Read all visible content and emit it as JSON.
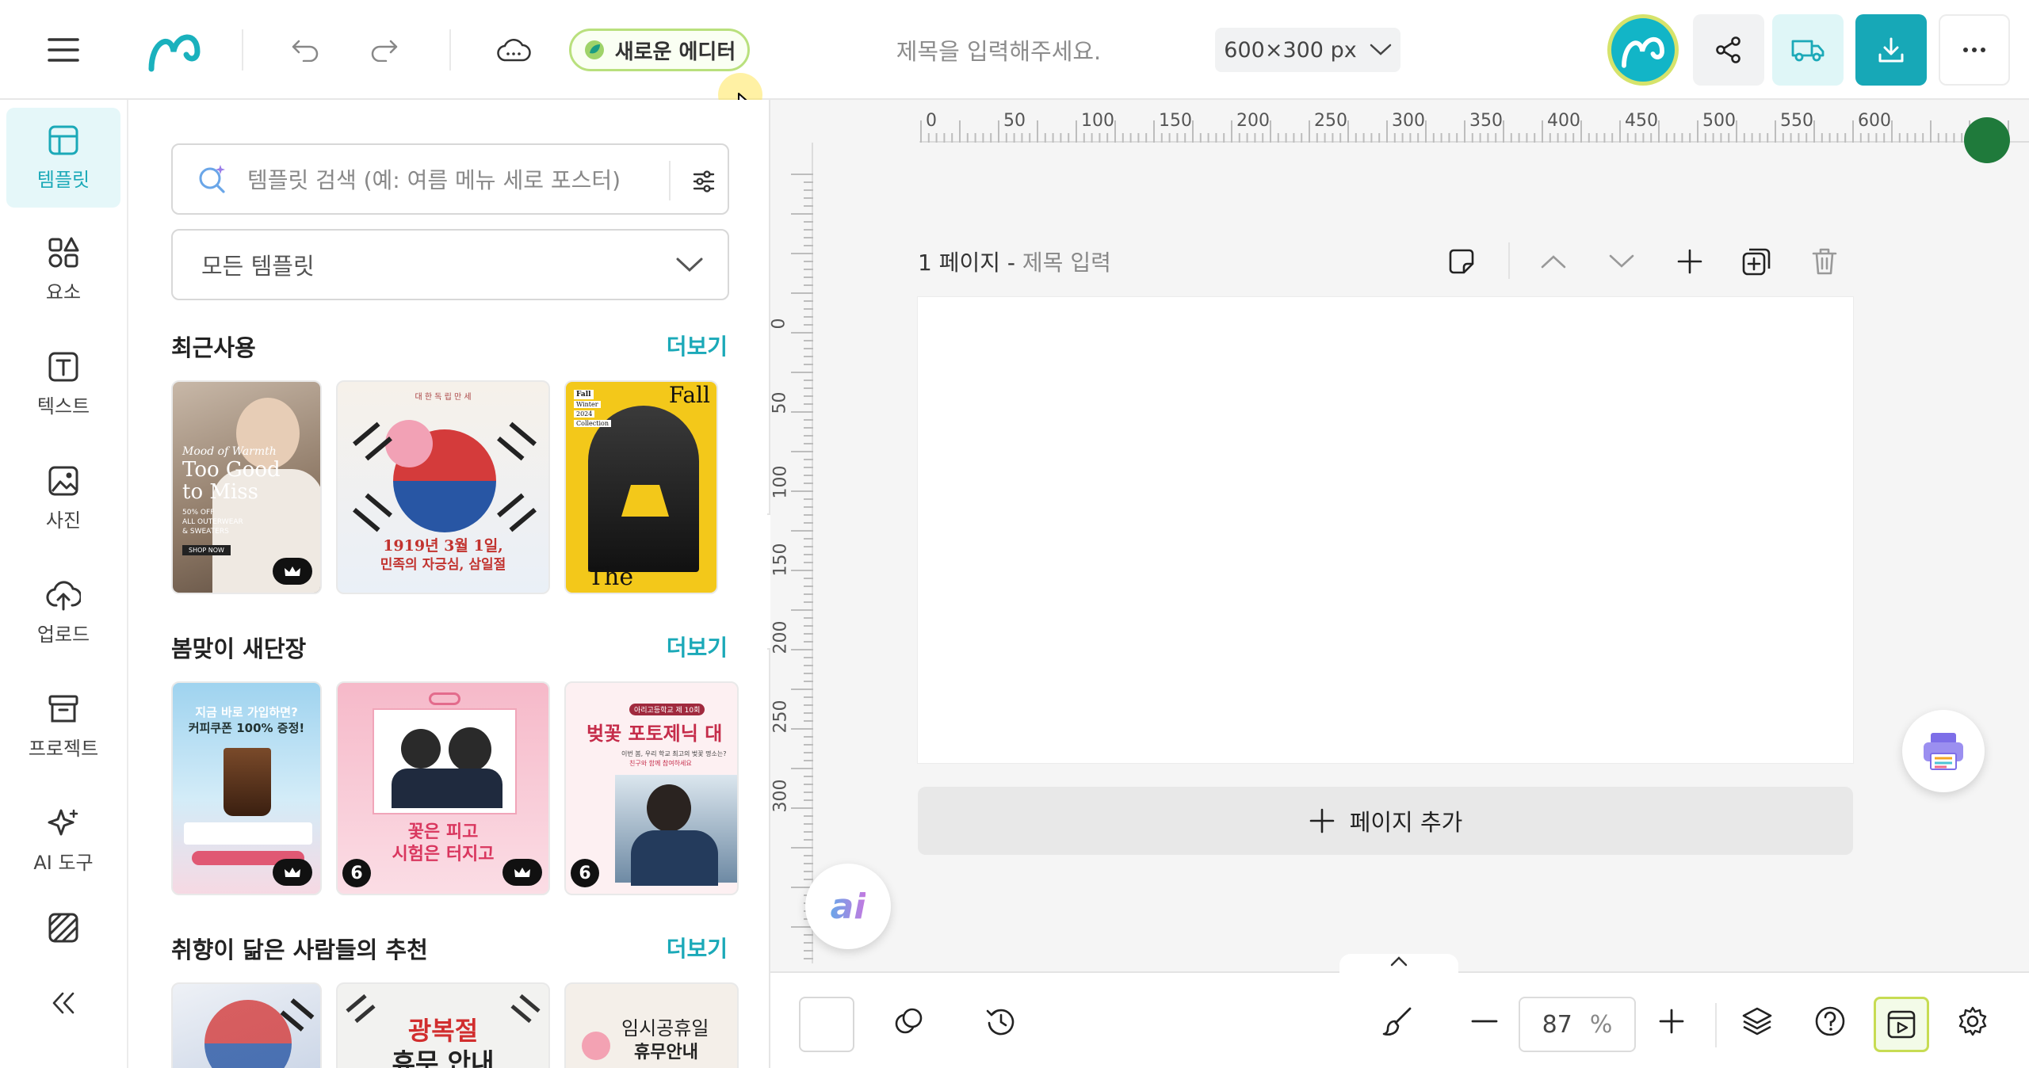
{
  "topbar": {
    "new_editor_label": "새로운 에디터",
    "title_placeholder": "제목을 입력해주세요.",
    "canvas_size": "600×300 px"
  },
  "rail": {
    "items": [
      {
        "label": "템플릿",
        "icon": "template-icon",
        "active": true
      },
      {
        "label": "요소",
        "icon": "elements-icon"
      },
      {
        "label": "텍스트",
        "icon": "text-icon"
      },
      {
        "label": "사진",
        "icon": "photo-icon"
      },
      {
        "label": "업로드",
        "icon": "upload-cloud-icon"
      },
      {
        "label": "프로젝트",
        "icon": "project-box-icon"
      },
      {
        "label": "AI 도구",
        "icon": "ai-sparkle-icon"
      },
      {
        "label": "",
        "icon": "pattern-icon"
      }
    ]
  },
  "panel": {
    "search_placeholder": "템플릿 검색 (예: 여름 메뉴 세로 포스터)",
    "category": "모든 템플릿",
    "sections": [
      {
        "title": "최근사용",
        "more": "더보기"
      },
      {
        "title": "봄맞이 새단장",
        "more": "더보기"
      },
      {
        "title": "취향이 닮은 사람들의 추천",
        "more": "더보기"
      }
    ],
    "recent_thumbs": [
      {
        "lines": [
          "Mood of Warmth",
          "Too Good",
          "to Miss",
          "50% OFF",
          "ALL OUTERWEAR",
          "& SWEATERS",
          "SHOP NOW"
        ]
      },
      {
        "lines": [
          "대 한 독 립 만 세",
          "1919년 3월 1일,",
          "민족의 자긍심, 삼일절"
        ]
      },
      {
        "lines": [
          "Fall",
          "Winter",
          "2024",
          "Collection",
          "Fall",
          "The"
        ]
      }
    ],
    "spring_thumbs": [
      {
        "lines": [
          "지금 바로 가입하면?",
          "커피쿠폰 100% 증정!"
        ]
      },
      {
        "lines": [
          "꽃은 피고",
          "시험은 터지고"
        ],
        "count": "6"
      },
      {
        "lines": [
          "아리고등학교 제 10회",
          "벚꽃 포토제닉 대",
          "이번 봄, 우리 학교 최고의 벚꽃 명소는?",
          "친구와 함께 참여하세요"
        ],
        "count": "6"
      }
    ],
    "recommend_thumbs": [
      {
        "lines": []
      },
      {
        "lines": [
          "광복절",
          "휴무 안내"
        ]
      },
      {
        "lines": [
          "임시공휴일",
          "휴무안내"
        ]
      }
    ]
  },
  "canvas": {
    "ruler_h": [
      "0",
      "50",
      "100",
      "150",
      "200",
      "250",
      "300",
      "350",
      "400",
      "450",
      "500",
      "550",
      "600"
    ],
    "ruler_v": [
      "0",
      "50",
      "100",
      "150",
      "200",
      "250",
      "300"
    ],
    "page_number": "1 페이지",
    "page_sep": "-",
    "page_title_placeholder": "제목 입력",
    "add_page": "페이지 추가",
    "ai_label": "ai"
  },
  "bottombar": {
    "zoom": "87",
    "zoom_unit": "%"
  },
  "colors": {
    "accent": "#1ba9b8",
    "download_bg": "#17a8b7",
    "new_editor_border": "#b9e07d"
  }
}
